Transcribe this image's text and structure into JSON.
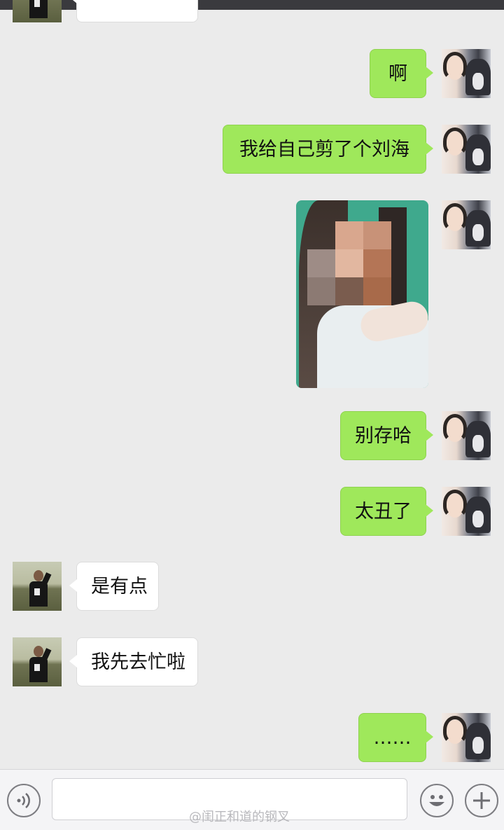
{
  "messages": [
    {
      "side": "out",
      "text": "啊"
    },
    {
      "side": "out",
      "text": "我给自己剪了个刘海"
    },
    {
      "side": "out",
      "type": "image",
      "description_alt": ""
    },
    {
      "side": "out",
      "text": "别存哈"
    },
    {
      "side": "out",
      "text": "太丑了"
    },
    {
      "side": "in",
      "text": "是有点"
    },
    {
      "side": "in",
      "text": "我先去忙啦"
    },
    {
      "side": "out",
      "text": "……"
    }
  ],
  "watermark": "@闺正和道的钢叉",
  "colors": {
    "outgoing_bubble": "#9fe85b",
    "incoming_bubble": "#ffffff",
    "chat_background": "#ebebeb"
  },
  "icons": {
    "voice": "voice-icon",
    "emoji": "emoji-icon",
    "more": "plus-icon"
  }
}
